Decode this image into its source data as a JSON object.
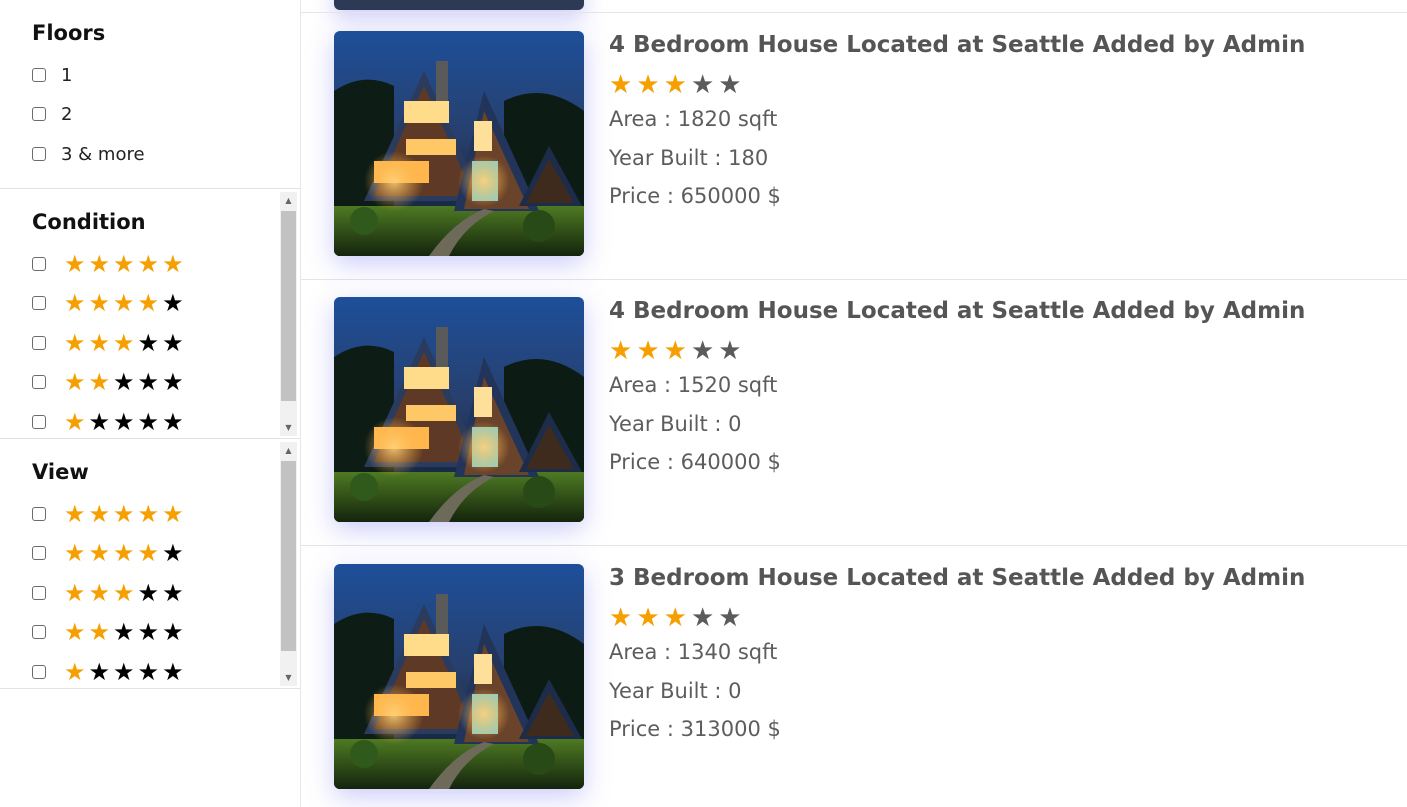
{
  "filters": {
    "floors": {
      "title": "Floors",
      "options": [
        "1",
        "2",
        "3 & more"
      ]
    },
    "condition": {
      "title": "Condition",
      "ratings": [
        5,
        4,
        3,
        2,
        1
      ]
    },
    "view": {
      "title": "View",
      "ratings": [
        5,
        4,
        3,
        2,
        1
      ]
    }
  },
  "listings": [
    {
      "title": "4 Bedroom House Located at Seattle Added by Admin",
      "rating": 3,
      "area": "Area : 1820 sqft",
      "year_built": "Year Built : 180",
      "price": "Price : 650000 $"
    },
    {
      "title": "4 Bedroom House Located at Seattle Added by Admin",
      "rating": 3,
      "area": "Area : 1520 sqft",
      "year_built": "Year Built : 0",
      "price": "Price : 640000 $"
    },
    {
      "title": "3 Bedroom House Located at Seattle Added by Admin",
      "rating": 3,
      "area": "Area : 1340 sqft",
      "year_built": "Year Built : 0",
      "price": "Price : 313000 $"
    }
  ],
  "icons": {
    "star": "star-icon",
    "checkbox": "checkbox-icon"
  },
  "colors": {
    "star_filled": "#f5a000",
    "star_empty_filter": "#000000",
    "star_empty_listing": "#5b5b5b",
    "text_gray": "#5d5d5d"
  }
}
